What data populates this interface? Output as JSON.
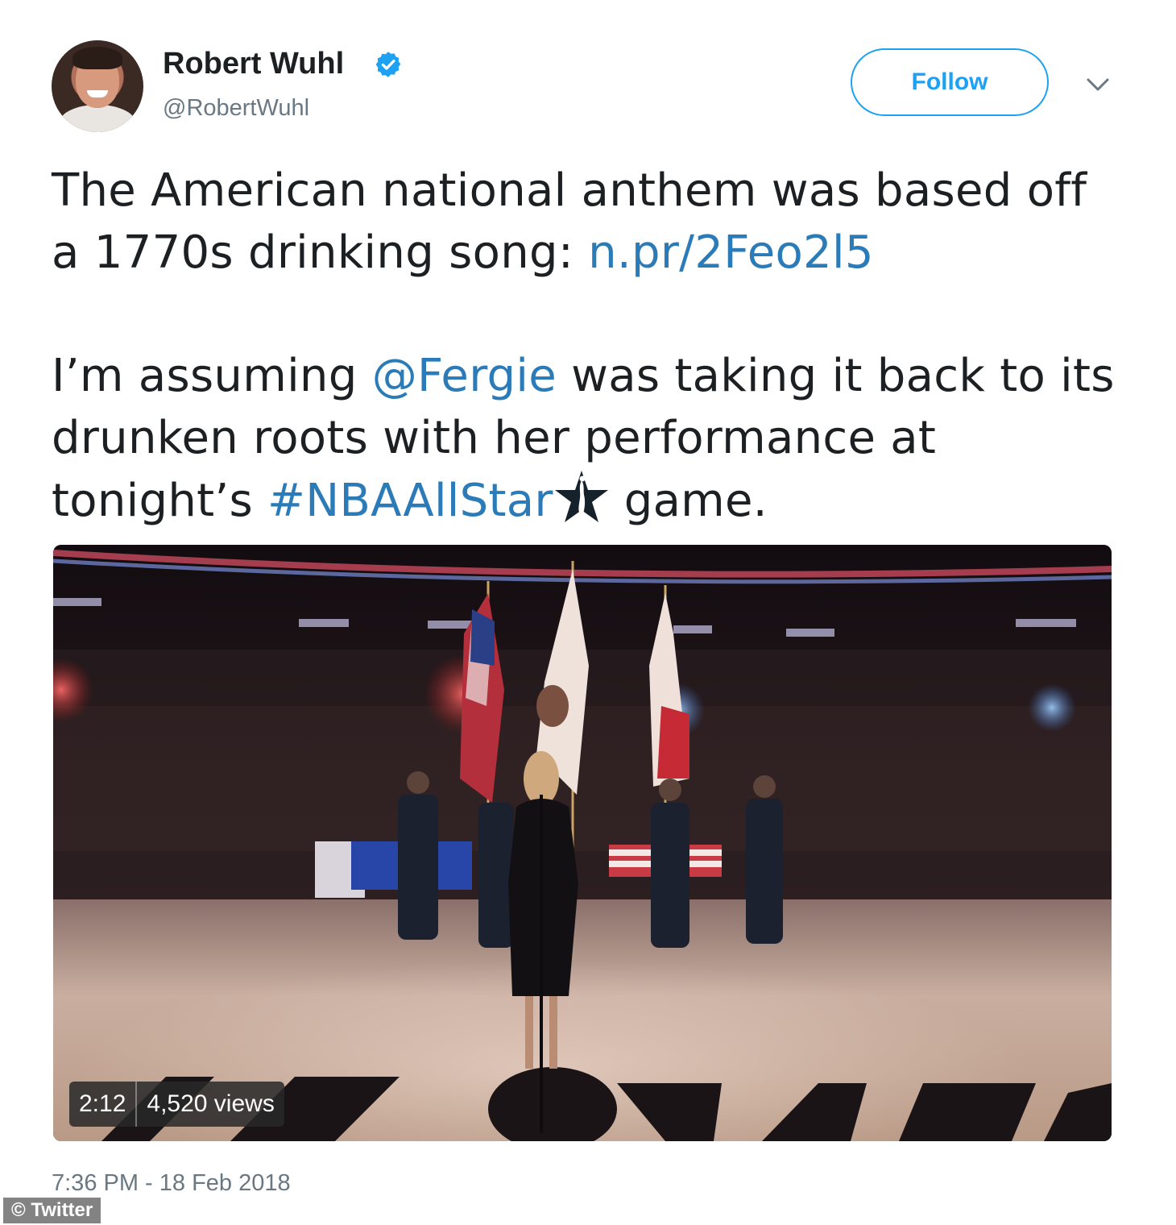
{
  "author": {
    "display_name": "Robert Wuhl",
    "handle": "@RobertWuhl",
    "verified": true
  },
  "actions": {
    "follow_label": "Follow"
  },
  "tweet": {
    "p1_text": "The American national anthem was based off a 1770s drinking song: ",
    "p1_link": "n.pr/2Feo2l5",
    "p2_before": "I’m assuming ",
    "p2_mention": "@Fergie",
    "p2_middle": " was taking it back to its drunken roots with her performance at tonight’s ",
    "p2_hashtag": "#NBAAllStar",
    "p2_after": "game."
  },
  "video": {
    "duration": "2:12",
    "views": "4,520 views"
  },
  "footer": {
    "timestamp": "7:36 PM - 18 Feb 2018",
    "watermark": "© Twitter"
  },
  "colors": {
    "link": "#2b7bb9",
    "follow_blue": "#1da1f2",
    "verified_blue": "#1da1f2",
    "muted_text": "#697882",
    "text": "#1c2022"
  },
  "icons": {
    "verified": "verified-badge-icon",
    "more": "chevron-down-icon",
    "hashtag_emoji": "nba-all-star-icon"
  }
}
